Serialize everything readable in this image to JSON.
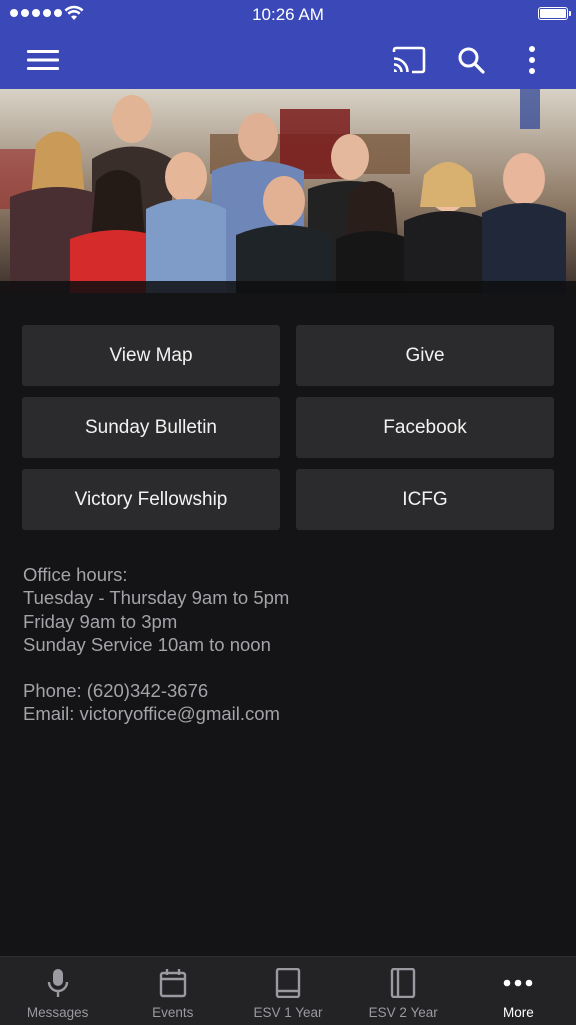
{
  "status_bar": {
    "time": "10:26 AM"
  },
  "nav_bar": {
    "menu_icon": "hamburger-menu-icon",
    "cast_icon": "cast-icon",
    "search_icon": "search-icon",
    "more_icon": "vertical-dots-icon"
  },
  "hero": {
    "image": "church staff group photo"
  },
  "tiles": [
    {
      "label": "View Map"
    },
    {
      "label": "Give"
    },
    {
      "label": "Sunday Bulletin"
    },
    {
      "label": "Facebook"
    },
    {
      "label": "Victory Fellowship"
    },
    {
      "label": "ICFG"
    }
  ],
  "info": {
    "lines1": [
      "Office hours:",
      "Tuesday - Thursday 9am to 5pm",
      "Friday 9am to 3pm",
      "Sunday Service 10am to noon"
    ],
    "lines2": [
      "Phone: (620)342-3676",
      "Email: victoryoffice@gmail.com"
    ]
  },
  "tab_bar": {
    "tabs": [
      {
        "label": "Messages",
        "icon": "microphone-icon",
        "active": false
      },
      {
        "label": "Events",
        "icon": "calendar-icon",
        "active": false
      },
      {
        "label": "ESV 1 Year",
        "icon": "book-icon",
        "active": false
      },
      {
        "label": "ESV 2 Year",
        "icon": "book-open-icon",
        "active": false
      },
      {
        "label": "More",
        "icon": "more-dots-icon",
        "active": true
      }
    ]
  },
  "colors": {
    "primary": "#3a48b8",
    "background": "#141416",
    "tile": "#2b2b2d",
    "tab_bar": "#232325"
  }
}
